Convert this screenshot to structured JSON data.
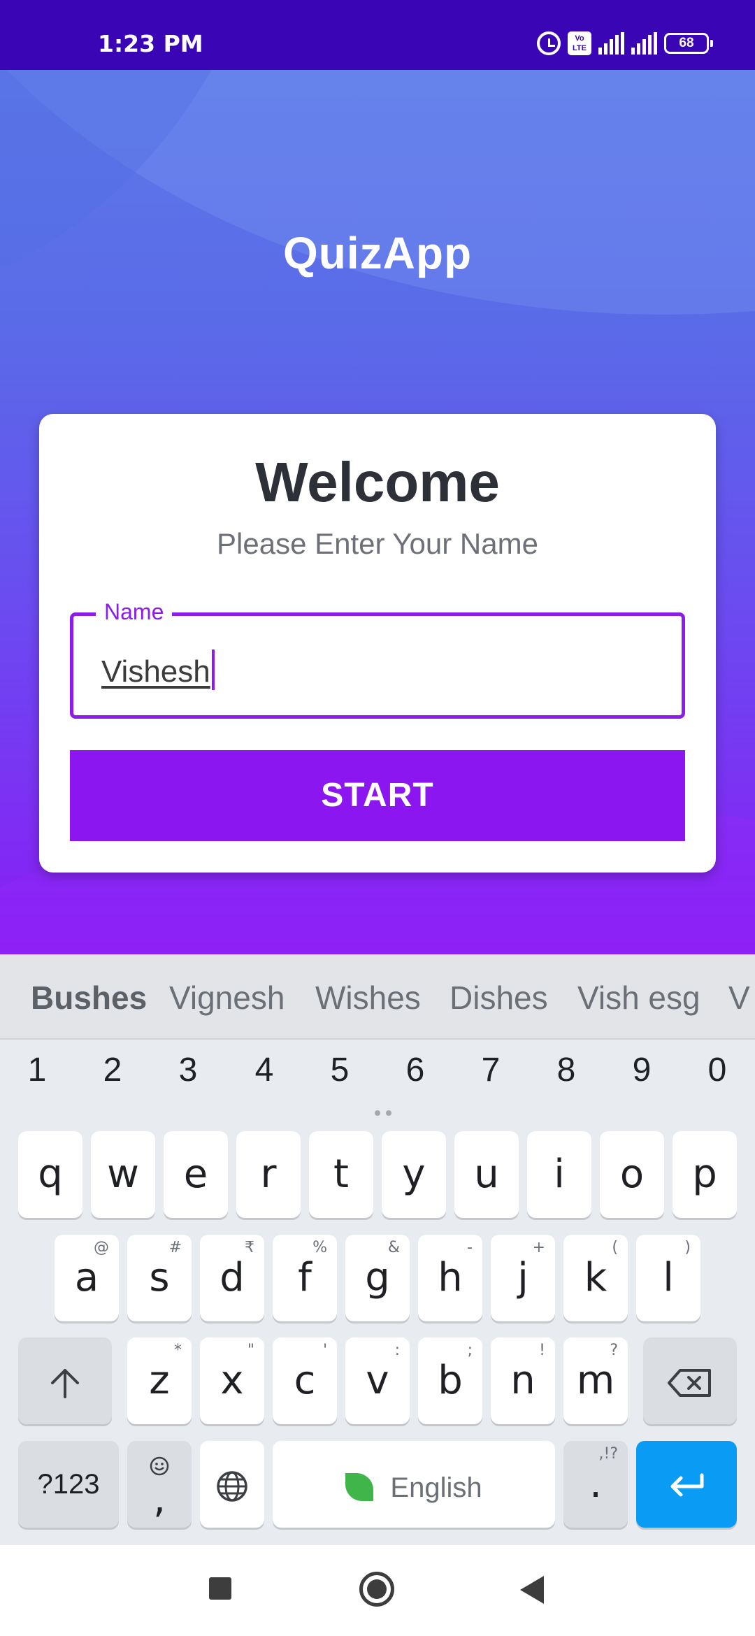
{
  "status_bar": {
    "time": "1:23 PM",
    "battery": "68",
    "volte": "Vo LTE",
    "icons": [
      "alarm-icon",
      "volte-icon",
      "signal-icon",
      "signal-icon",
      "battery-icon"
    ]
  },
  "app": {
    "title": "QuizApp",
    "card": {
      "heading": "Welcome",
      "subtitle": "Please Enter Your Name",
      "name_field": {
        "label": "Name",
        "value": "Vishesh"
      },
      "start_label": "START"
    }
  },
  "keyboard": {
    "suggestions": [
      "Bushes",
      "Vignesh",
      "Wishes",
      "Dishes",
      "Vish esg",
      "V"
    ],
    "numbers": [
      "1",
      "2",
      "3",
      "4",
      "5",
      "6",
      "7",
      "8",
      "9",
      "0"
    ],
    "row1": [
      "q",
      "w",
      "e",
      "r",
      "t",
      "y",
      "u",
      "i",
      "o",
      "p"
    ],
    "row2": [
      {
        "key": "a",
        "hint": "@"
      },
      {
        "key": "s",
        "hint": "#"
      },
      {
        "key": "d",
        "hint": "₹"
      },
      {
        "key": "f",
        "hint": "%"
      },
      {
        "key": "g",
        "hint": "&"
      },
      {
        "key": "h",
        "hint": "-"
      },
      {
        "key": "j",
        "hint": "+"
      },
      {
        "key": "k",
        "hint": "("
      },
      {
        "key": "l",
        "hint": ")"
      }
    ],
    "row3": [
      {
        "key": "z",
        "hint": "*"
      },
      {
        "key": "x",
        "hint": "\""
      },
      {
        "key": "c",
        "hint": "'"
      },
      {
        "key": "v",
        "hint": ":"
      },
      {
        "key": "b",
        "hint": ";"
      },
      {
        "key": "n",
        "hint": "!"
      },
      {
        "key": "m",
        "hint": "?"
      }
    ],
    "symbols_label": "?123",
    "comma_label": ",",
    "space_label": "English",
    "period_label": ".",
    "period_hint": ",!?"
  },
  "colors": {
    "status_bar": "#3a06b5",
    "accent_purple": "#8c16ef",
    "enter_key": "#0a9cf5"
  }
}
